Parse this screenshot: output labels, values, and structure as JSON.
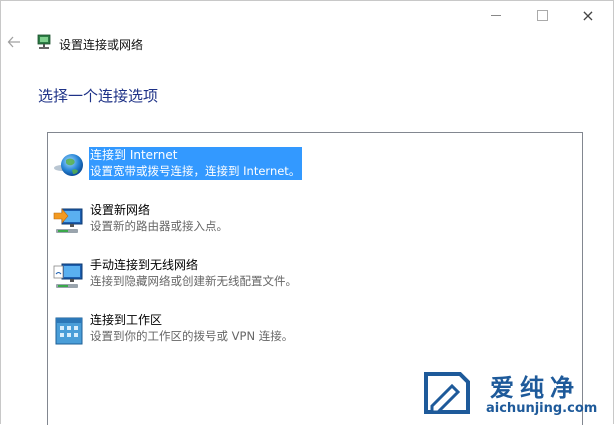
{
  "window": {
    "title": "设置连接或网络",
    "controls": {
      "minimize": "minimize-icon",
      "maximize": "maximize-icon",
      "close": "×"
    }
  },
  "heading": "选择一个连接选项",
  "options": [
    {
      "label": "连接到 Internet",
      "description": "设置宽带或拨号连接，连接到 Internet。",
      "icon": "globe-icon",
      "selected": true
    },
    {
      "label": "设置新网络",
      "description": "设置新的路由器或接入点。",
      "icon": "new-network-icon",
      "selected": false
    },
    {
      "label": "手动连接到无线网络",
      "description": "连接到隐藏网络或创建新无线配置文件。",
      "icon": "wireless-network-icon",
      "selected": false
    },
    {
      "label": "连接到工作区",
      "description": "设置到你的工作区的拨号或 VPN 连接。",
      "icon": "workplace-icon",
      "selected": false
    }
  ],
  "watermark": {
    "name": "爱纯净",
    "url": "aichunjing.com"
  },
  "colors": {
    "heading": "#1e3287",
    "selection": "#3399ff",
    "watermark": "#1e5a9a"
  }
}
